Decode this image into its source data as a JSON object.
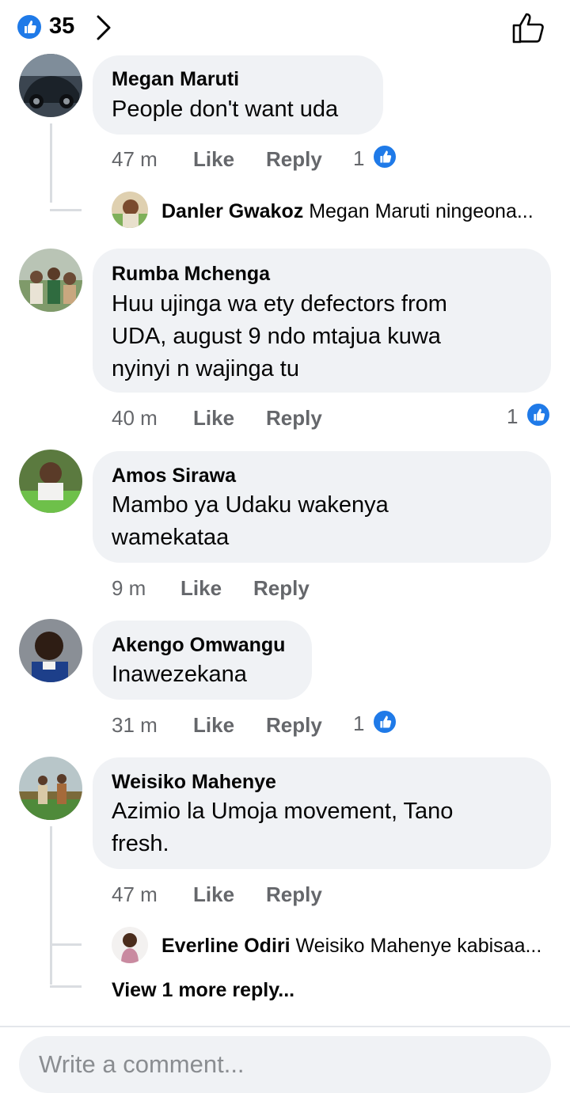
{
  "header": {
    "reaction_count": "35"
  },
  "comments": [
    {
      "name": "Megan Maruti",
      "text": [
        "People don't want uda"
      ],
      "time": "47 m",
      "like": "Like",
      "reply": "Reply",
      "reactions": "1"
    },
    {
      "name": "Rumba Mchenga",
      "text": [
        "Huu ujinga wa ety defectors from",
        "UDA, august 9 ndo mtajua kuwa",
        "nyinyi n wajinga tu"
      ],
      "time": "40 m",
      "like": "Like",
      "reply": "Reply",
      "reactions": "1"
    },
    {
      "name": "Amos Sirawa",
      "text": [
        "Mambo ya Udaku wakenya",
        "wamekataa"
      ],
      "time": "9 m",
      "like": "Like",
      "reply": "Reply"
    },
    {
      "name": "Akengo Omwangu",
      "text": [
        "Inawezekana"
      ],
      "time": "31 m",
      "like": "Like",
      "reply": "Reply",
      "reactions": "1"
    },
    {
      "name": "Weisiko Mahenye",
      "text": [
        "Azimio  la Umoja movement, Tano",
        "fresh."
      ],
      "time": "47 m",
      "like": "Like",
      "reply": "Reply"
    }
  ],
  "replies": [
    {
      "name": "Danler Gwakoz",
      "preview": "Megan Maruti ningeona..."
    },
    {
      "name": "Everline Odiri",
      "preview": "Weisiko Mahenye kabisaa..."
    }
  ],
  "view_more": "View 1 more reply...",
  "composer": {
    "placeholder": "Write a comment..."
  },
  "colors": {
    "accent": "#1f7ae8",
    "bubble": "#f0f2f5",
    "meta": "#65676b"
  }
}
